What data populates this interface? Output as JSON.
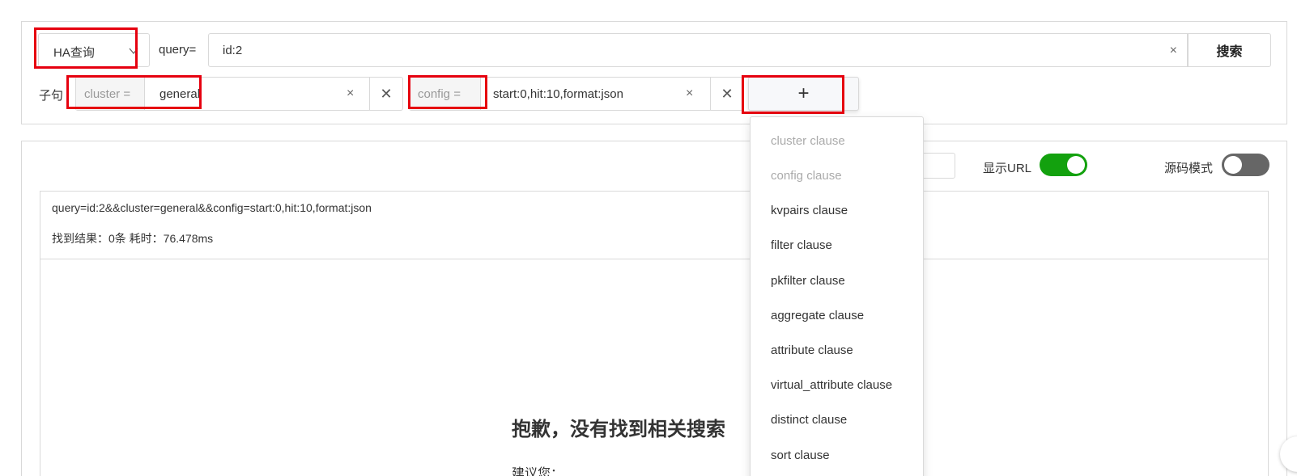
{
  "search": {
    "mode": "HA查询",
    "query_label": "query=",
    "query_value": "id:2",
    "clear_glyph": "×",
    "submit_label": "搜索"
  },
  "clauses": {
    "label": "子句",
    "items": [
      {
        "key": "cluster =",
        "value": "general"
      },
      {
        "key": "config =",
        "value": "start:0,hit:10,format:json"
      }
    ],
    "remove_glyph": "✕",
    "add_glyph": "+"
  },
  "dropdown": {
    "items": [
      {
        "label": "cluster clause",
        "disabled": true
      },
      {
        "label": "config clause",
        "disabled": true
      },
      {
        "label": "kvpairs clause",
        "disabled": false
      },
      {
        "label": "filter clause",
        "disabled": false
      },
      {
        "label": "pkfilter clause",
        "disabled": false
      },
      {
        "label": "aggregate clause",
        "disabled": false
      },
      {
        "label": "attribute clause",
        "disabled": false
      },
      {
        "label": "virtual_attribute clause",
        "disabled": false
      },
      {
        "label": "distinct clause",
        "disabled": false
      },
      {
        "label": "sort clause",
        "disabled": false
      }
    ]
  },
  "toolbar": {
    "show_url_label": "显示URL",
    "show_url_on": true,
    "source_mode_label": "源码模式",
    "source_mode_on": false
  },
  "result": {
    "url": "query=id:2&&cluster=general&&config=start:0,hit:10,format:json",
    "stats": "找到结果：0条  耗时：76.478ms",
    "empty_title": "抱歉，没有找到相关搜索",
    "suggest": "建议您："
  },
  "colors": {
    "highlight": "#e6000f",
    "toggle_on": "#13a10e",
    "toggle_off": "#666666"
  }
}
